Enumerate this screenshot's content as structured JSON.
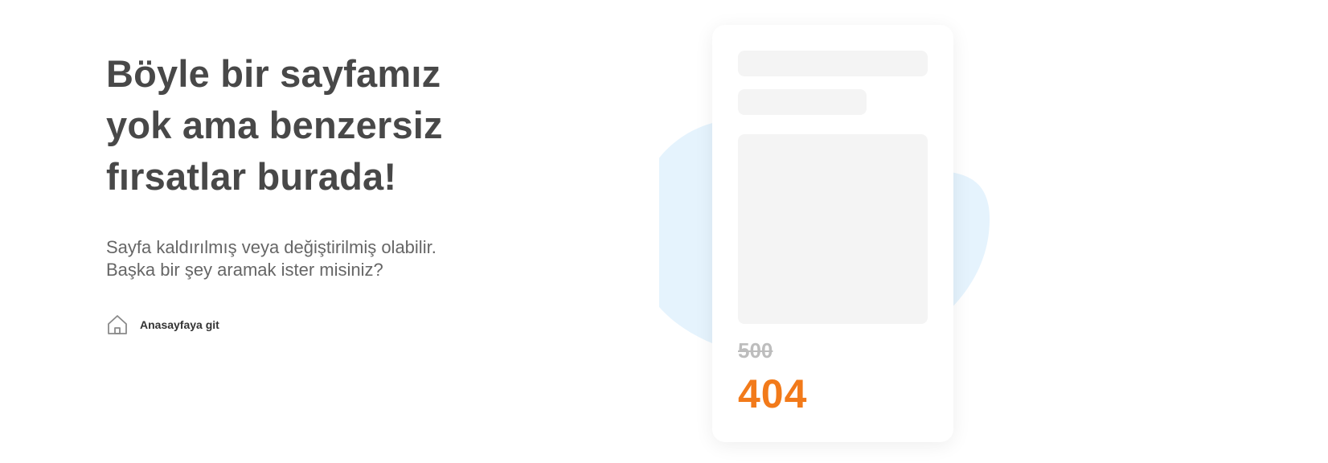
{
  "main": {
    "headline": "Böyle bir sayfamız\nyok ama benzersiz\nfırsatlar burada!",
    "description": "Sayfa kaldırılmış veya değiştirilmiş olabilir.\nBaşka bir şey aramak ister misiniz?",
    "home_link": {
      "icon": "home-icon",
      "label": "Anasayfaya git"
    }
  },
  "illustration": {
    "old_price": "500",
    "new_price": "404",
    "colors": {
      "blob": "#e5f3fd",
      "skeleton": "#f4f4f4",
      "new_price": "#f27a1a",
      "old_price": "#bdbdbd"
    }
  }
}
